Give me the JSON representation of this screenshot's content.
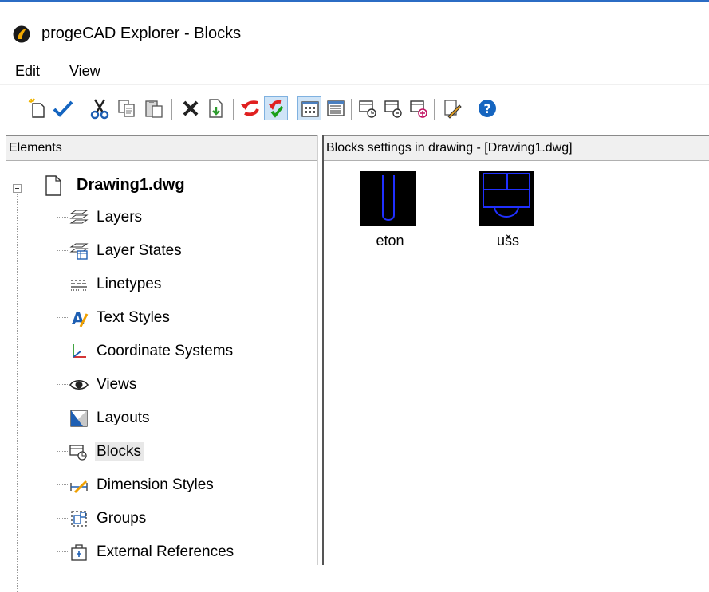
{
  "window": {
    "title": "progeCAD Explorer - Blocks",
    "accent": "#2b6cc4"
  },
  "menu": {
    "items": [
      {
        "label": "Edit"
      },
      {
        "label": "View"
      }
    ]
  },
  "toolbar": {
    "buttons": [
      {
        "icon": "new-item-icon"
      },
      {
        "icon": "checkmark-icon"
      },
      {
        "icon": "cut-icon"
      },
      {
        "icon": "copy-icon"
      },
      {
        "icon": "paste-icon"
      },
      {
        "icon": "delete-icon"
      },
      {
        "icon": "insert-icon"
      },
      {
        "icon": "purge-icon"
      },
      {
        "icon": "purge-all-icon"
      },
      {
        "icon": "large-icons-view-icon"
      },
      {
        "icon": "details-view-icon"
      },
      {
        "icon": "block-icon-1"
      },
      {
        "icon": "block-icon-2"
      },
      {
        "icon": "block-icon-3"
      },
      {
        "icon": "edit-pencil-icon"
      },
      {
        "icon": "help-icon"
      }
    ]
  },
  "left_pane": {
    "header": "Elements",
    "root": {
      "label": "Drawing1.dwg"
    },
    "nodes": [
      {
        "label": "Layers",
        "icon": "layers-icon"
      },
      {
        "label": "Layer States",
        "icon": "layer-states-icon"
      },
      {
        "label": "Linetypes",
        "icon": "linetypes-icon"
      },
      {
        "label": "Text Styles",
        "icon": "text-styles-icon"
      },
      {
        "label": "Coordinate Systems",
        "icon": "coordinate-systems-icon"
      },
      {
        "label": "Views",
        "icon": "views-eye-icon"
      },
      {
        "label": "Layouts",
        "icon": "layouts-icon"
      },
      {
        "label": "Blocks",
        "icon": "blocks-icon",
        "selected": true
      },
      {
        "label": "Dimension Styles",
        "icon": "dimension-styles-icon"
      },
      {
        "label": "Groups",
        "icon": "groups-icon"
      },
      {
        "label": "External References",
        "icon": "external-references-icon"
      }
    ]
  },
  "right_pane": {
    "header": "Blocks settings in drawing - [Drawing1.dwg]",
    "blocks": [
      {
        "label": "eton"
      },
      {
        "label": "ušs"
      }
    ]
  }
}
